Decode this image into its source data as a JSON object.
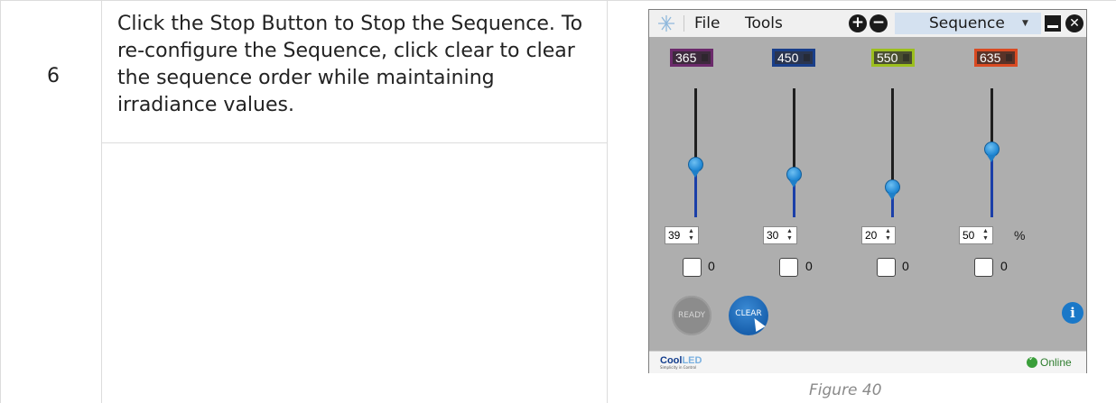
{
  "step": {
    "number": "6",
    "text": "Click the Stop Button to Stop the Sequence. To re-configure the Sequence, click clear to clear the sequence order while maintaining irradiance values."
  },
  "window": {
    "menu": [
      "File",
      "Tools"
    ],
    "sequence_label": "Sequence",
    "channels": [
      {
        "wavelength": "365",
        "color": "#6b2a6b",
        "intensity": "39",
        "count": "0"
      },
      {
        "wavelength": "450",
        "color": "#1a3f8a",
        "intensity": "30",
        "count": "0"
      },
      {
        "wavelength": "550",
        "color": "#9cbf1e",
        "intensity": "20",
        "count": "0"
      },
      {
        "wavelength": "635",
        "color": "#d94a22",
        "intensity": "50",
        "count": "0"
      }
    ],
    "percent_unit": "%",
    "ready_label": "READY",
    "clear_label": "CLEAR",
    "brand": {
      "cool": "Cool",
      "led": "LED",
      "tagline": "Simplicity in Control"
    },
    "status": "Online"
  },
  "caption": "Figure 40"
}
